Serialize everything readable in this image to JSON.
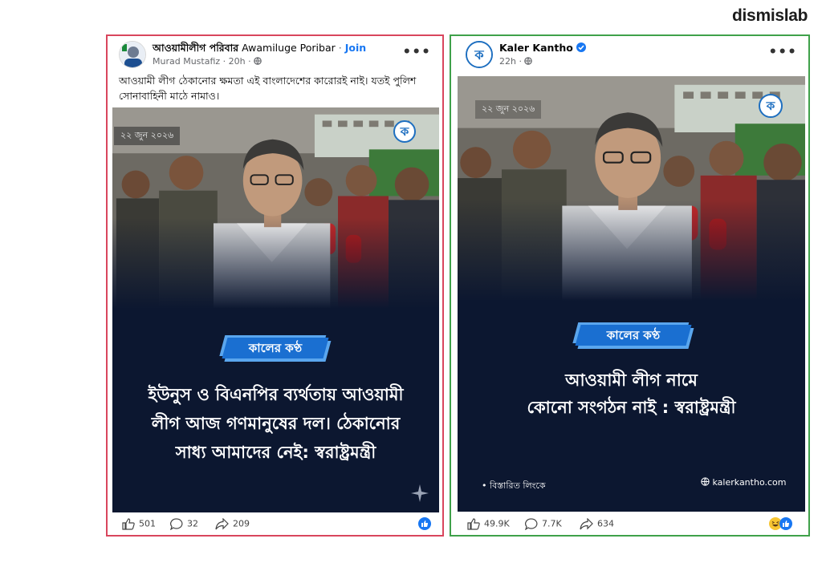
{
  "brand": {
    "logo_text": "dismislab"
  },
  "left_post": {
    "page_name": "আওয়ামীলীগ পরিবার",
    "page_name_latin": "Awamiluge Poribar",
    "separator": "·",
    "join_label": "Join",
    "author": "Murad Mustafiz",
    "time": "20h",
    "caption": "আওয়ামী লীগ ঠেকানোর ক্ষমতা এই বাংলাদেশের কারোরই নাই। যতই পুলিশ সোনাবাহিনী মাঠে নামাও।",
    "image": {
      "date_text": "২২ জুন ২০২৬",
      "logo_badge": "কালের কণ্ঠ",
      "headline_line1": "ইউনুস ও বিএনপির ব্যর্থতায় আওয়ামী",
      "headline_line2": "লীগ আজ গণমানুষের দল। ঠেকানোর",
      "headline_line3": "সাধ্য আমাদের নেই: স্বরাষ্ট্রমন্ত্রী"
    },
    "stats": {
      "likes": "501",
      "comments": "32",
      "shares": "209"
    }
  },
  "right_post": {
    "page_name": "Kaler Kantho",
    "time": "22h",
    "image": {
      "date_text": "২২ জুন ২০২৬",
      "logo_badge": "কালের কণ্ঠ",
      "headline_line1": "আওয়ামী লীগ নামে",
      "headline_line2": "কোনো সংগঠন নাই : স্বরাষ্ট্রমন্ত্রী",
      "footer_left": "বিস্তারিত লিংকে",
      "footer_url": "kalerkantho.com"
    },
    "stats": {
      "likes": "49.9K",
      "comments": "7.7K",
      "shares": "634"
    }
  },
  "colors": {
    "left_border": "#d9465d",
    "right_border": "#3fa14a",
    "facebook_blue": "#1877f2",
    "badge_blue": "#1a6fd1",
    "panel_navy": "#0c1730"
  }
}
